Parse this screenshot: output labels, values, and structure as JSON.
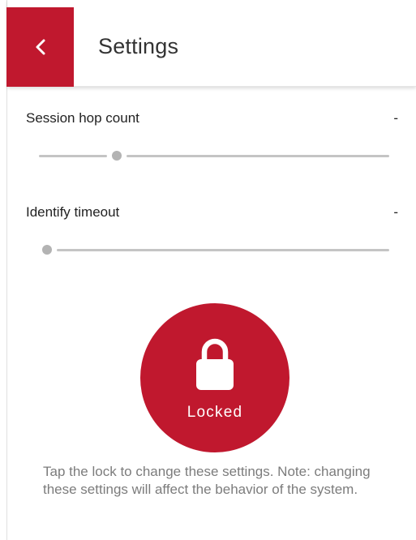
{
  "header": {
    "title": "Settings",
    "back_icon": "chevron-left-icon",
    "accent_color": "#c0182e"
  },
  "settings": [
    {
      "label": "Session hop count",
      "value": "-",
      "slider_fraction": 0.22
    },
    {
      "label": "Identify timeout",
      "value": "-",
      "slider_fraction": 0.0
    }
  ],
  "lock": {
    "icon": "lock-icon",
    "label": "Locked",
    "color": "#c0182e"
  },
  "note": "Tap the lock to change these settings. Note: changing these settings will affect the behavior of the system."
}
